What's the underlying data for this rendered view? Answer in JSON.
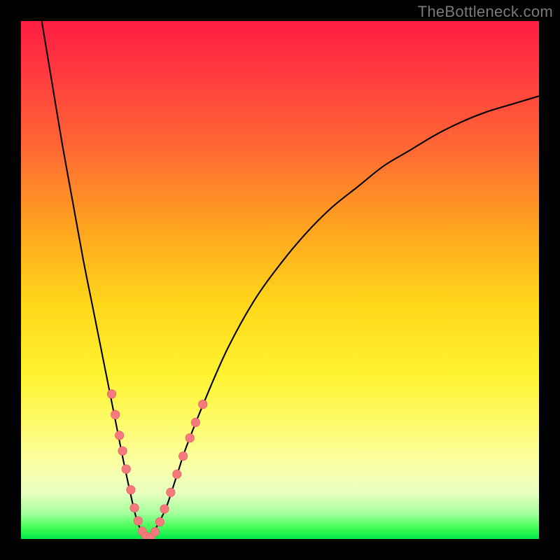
{
  "watermark": "TheBottleneck.com",
  "colors": {
    "background": "#000000",
    "gradient_top": "#ff1d43",
    "gradient_bottom": "#00e84a",
    "curve": "#000000",
    "marker": "#f47a7d"
  },
  "chart_data": {
    "type": "line",
    "title": "",
    "xlabel": "",
    "ylabel": "",
    "xlim": [
      0,
      100
    ],
    "ylim": [
      0,
      100
    ],
    "grid": false,
    "series": [
      {
        "name": "bottleneck-curve",
        "x": [
          4,
          6,
          8,
          10,
          12,
          14,
          16,
          18,
          20,
          22,
          23,
          24,
          25,
          26,
          28,
          30,
          32,
          36,
          40,
          45,
          50,
          55,
          60,
          65,
          70,
          75,
          80,
          85,
          90,
          95,
          100
        ],
        "y": [
          100,
          88,
          76,
          65,
          54,
          44,
          34,
          24,
          14,
          5,
          2,
          0,
          0,
          2,
          6,
          12,
          18,
          28,
          37,
          46,
          53,
          59,
          64,
          68,
          72,
          75,
          78,
          80.5,
          82.5,
          84,
          85.5
        ]
      }
    ],
    "markers": {
      "name": "data-points",
      "points": [
        {
          "x": 17.5,
          "y": 28
        },
        {
          "x": 18.2,
          "y": 24
        },
        {
          "x": 19.0,
          "y": 20
        },
        {
          "x": 19.6,
          "y": 17
        },
        {
          "x": 20.3,
          "y": 13.5
        },
        {
          "x": 21.2,
          "y": 9.5
        },
        {
          "x": 21.9,
          "y": 6
        },
        {
          "x": 22.6,
          "y": 3.5
        },
        {
          "x": 23.4,
          "y": 1.5
        },
        {
          "x": 24.2,
          "y": 0.5
        },
        {
          "x": 25.0,
          "y": 0.3
        },
        {
          "x": 25.9,
          "y": 1.4
        },
        {
          "x": 26.8,
          "y": 3.3
        },
        {
          "x": 27.7,
          "y": 5.8
        },
        {
          "x": 28.9,
          "y": 9
        },
        {
          "x": 30.1,
          "y": 12.5
        },
        {
          "x": 31.3,
          "y": 16
        },
        {
          "x": 32.6,
          "y": 19.5
        },
        {
          "x": 33.7,
          "y": 22.5
        },
        {
          "x": 35.1,
          "y": 26
        }
      ]
    }
  }
}
